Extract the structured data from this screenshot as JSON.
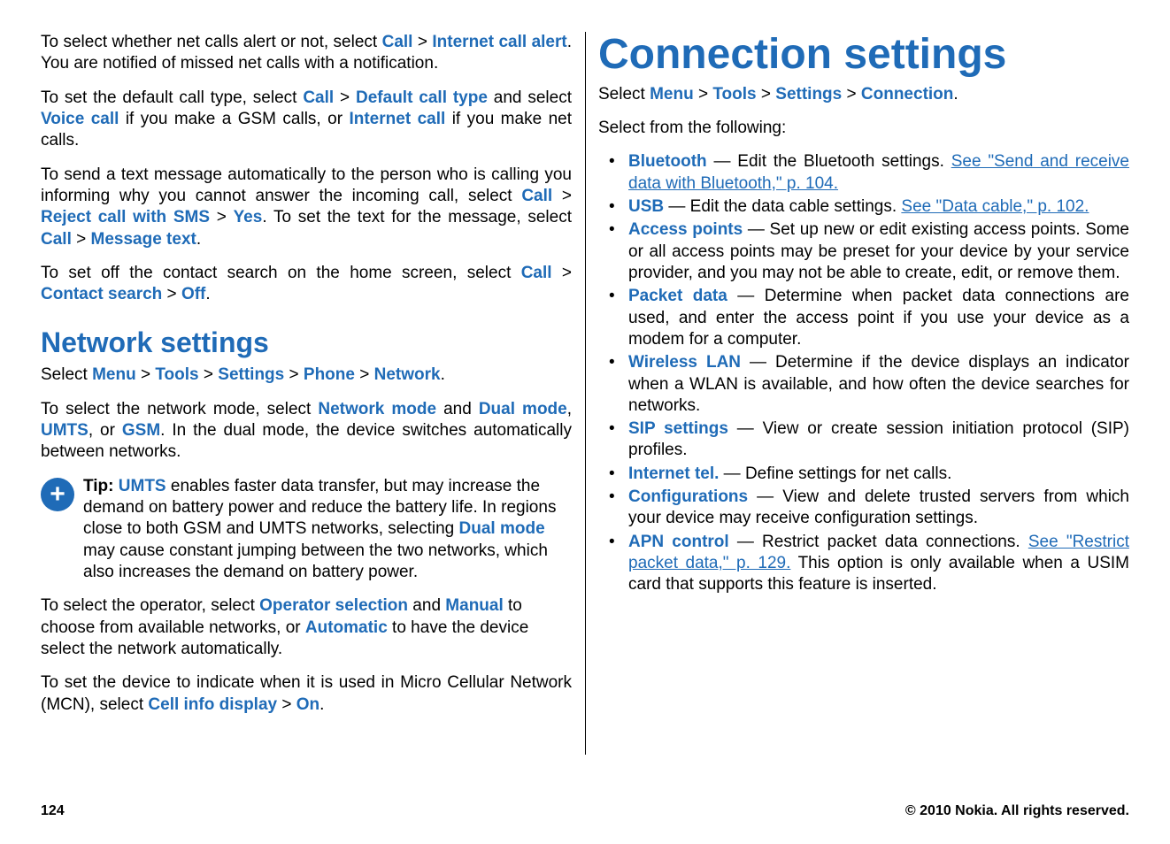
{
  "col1": {
    "p1": {
      "t1": "To select whether net calls alert or not, select ",
      "call": "Call",
      "gt1": " > ",
      "ica": "Internet call alert",
      "t2": ". You are notified of missed net calls with a notification."
    },
    "p2": {
      "t1": "To set the default call type, select ",
      "call": "Call",
      "gt1": " > ",
      "dct": "Default call type",
      "t2": " and select ",
      "vc": "Voice call",
      "t3": " if you make a GSM calls, or ",
      "ic": "Internet call",
      "t4": " if you make net calls."
    },
    "p3": {
      "t1": "To send a text message automatically to the person who is calling you informing why you cannot answer the incoming call, select ",
      "call": "Call",
      "gt1": " > ",
      "rej": "Reject call with SMS",
      "gt2": " > ",
      "yes": "Yes",
      "t2": ". To set the text for the message, select ",
      "call2": "Call",
      "gt3": " > ",
      "mt": "Message text",
      "t3": "."
    },
    "p4": {
      "t1": "To set off the contact search on the home screen, select ",
      "call": "Call",
      "gt1": " > ",
      "cs": "Contact search",
      "gt2": " > ",
      "off": "Off",
      "t2": "."
    },
    "h2": "Network settings",
    "p5": {
      "t1": "Select ",
      "menu": "Menu",
      "gt1": " > ",
      "tools": "Tools",
      "gt2": " > ",
      "settings": "Settings",
      "gt3": " > ",
      "phone": "Phone",
      "gt4": " > ",
      "network": "Network",
      "t2": "."
    },
    "p6": {
      "t1": "To select the network mode, select ",
      "nm": "Network mode",
      "t2": " and ",
      "dm": "Dual mode",
      "t3": ", ",
      "umts": "UMTS",
      "t4": ", or ",
      "gsm": "GSM",
      "t5": ". In the dual mode, the device switches automatically between networks."
    },
    "tip": {
      "label": "Tip:",
      "umts": "UMTS",
      "t1": " enables faster data transfer, but may increase the demand on battery power and reduce the battery life. In regions close to both GSM and UMTS networks, selecting ",
      "dm": "Dual mode",
      "t2": " may cause constant jumping between the two networks, which also increases the demand on battery power."
    },
    "p7": {
      "t1": "To select the operator, select ",
      "os": "Operator selection",
      "t2": " and ",
      "man": "Manual",
      "t3": " to choose from available networks, or ",
      "auto": "Automatic",
      "t4": " to have the device select the network automatically."
    }
  },
  "col2": {
    "p8": {
      "t1": "To set the device to indicate when it is used in Micro Cellular Network (MCN), select ",
      "cid": "Cell info display",
      "gt1": " > ",
      "on": "On",
      "t2": "."
    },
    "h1": "Connection settings",
    "p9": {
      "t1": "Select ",
      "menu": "Menu",
      "gt1": " > ",
      "tools": "Tools",
      "gt2": " > ",
      "settings": "Settings",
      "gt3": " > ",
      "conn": "Connection",
      "t2": "."
    },
    "p10": "Select from the following:",
    "items": [
      {
        "name": "Bluetooth",
        "desc": " — Edit the Bluetooth settings. ",
        "link": "See \"Send and receive data with Bluetooth,\" p. 104."
      },
      {
        "name": "USB",
        "desc": " — Edit the data cable settings. ",
        "link": "See \"Data cable,\" p. 102."
      },
      {
        "name": "Access points",
        "desc": " — Set up new or edit existing access points. Some or all access points may be preset for your device by your service provider, and you may not be able to create, edit, or remove them."
      },
      {
        "name": "Packet data",
        "desc": " — Determine when packet data connections are used, and enter the access point if you use your device as a modem for a computer."
      },
      {
        "name": "Wireless LAN",
        "desc": " — Determine if the device displays an indicator when a WLAN is available, and how often the device searches for networks."
      },
      {
        "name": "SIP settings",
        "desc": " — View or create session initiation protocol (SIP) profiles."
      },
      {
        "name": "Internet tel.",
        "desc": " — Define settings for net calls."
      },
      {
        "name": "Configurations",
        "desc": " — View and delete trusted servers from which your device may receive configuration settings."
      },
      {
        "name": "APN control",
        "desc": " — Restrict packet data connections. ",
        "link": "See \"Restrict packet data,\" p. 129.",
        "desc2": " This option is only available when a USIM card that supports this feature is inserted."
      }
    ]
  },
  "footer": {
    "page": "124",
    "copy": "© 2010 Nokia. All rights reserved."
  }
}
